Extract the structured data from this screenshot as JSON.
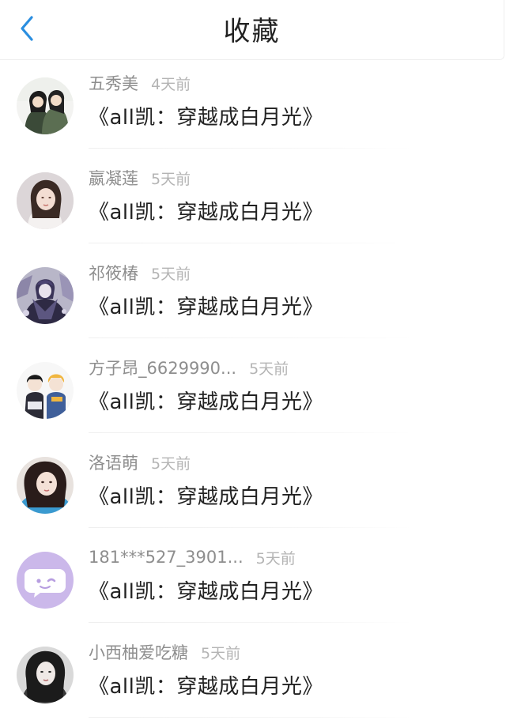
{
  "header": {
    "title": "收藏",
    "back_icon": "chevron-left-icon",
    "accent_color": "#2a8ee0"
  },
  "items": [
    {
      "user": "五秀美",
      "time": "4天前",
      "book": "《all凯：穿越成白月光》",
      "avatar": "avatar-anime-couple"
    },
    {
      "user": "嬴凝莲",
      "time": "5天前",
      "book": "《all凯：穿越成白月光》",
      "avatar": "avatar-photo-woman"
    },
    {
      "user": "祁筱椿",
      "time": "5天前",
      "book": "《all凯：穿越成白月光》",
      "avatar": "avatar-anime-dark-character"
    },
    {
      "user": "方子昂_6629990...",
      "time": "5天前",
      "book": "《all凯：穿越成白月光》",
      "avatar": "avatar-anime-duo"
    },
    {
      "user": "洛语萌",
      "time": "5天前",
      "book": "《all凯：穿越成白月光》",
      "avatar": "avatar-photo-girl-blue"
    },
    {
      "user": "181***527_3901...",
      "time": "5天前",
      "book": "《all凯：穿越成白月光》",
      "avatar": "avatar-default-chat-bubble"
    },
    {
      "user": "小西柚爱吃糖",
      "time": "5天前",
      "book": "《all凯：穿越成白月光》",
      "avatar": "avatar-photo-woman-dark"
    }
  ]
}
